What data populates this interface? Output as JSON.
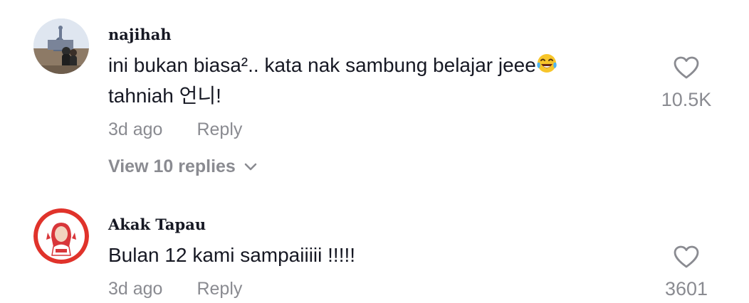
{
  "comments": [
    {
      "username": "najihah",
      "text": "ini bukan biasa². kata nak sambung belajar jeee",
      "text_line1": "ini bukan biasa².. kata nak sambung belajar jeee",
      "text_line2": "tahniah 언니!",
      "emoji": "face-with-tears-of-joy",
      "time": "3d ago",
      "reply_label": "Reply",
      "likes": "10.5K",
      "view_replies": "View 10 replies"
    },
    {
      "username": "Akak Tapau",
      "text_line1": "Bulan 12 kami sampaiiiii !!!!!",
      "time": "3d ago",
      "reply_label": "Reply",
      "likes": "3601"
    }
  ],
  "colors": {
    "text": "#161823",
    "secondary": "#8a8b91",
    "avatar2_ring": "#e0332b"
  }
}
